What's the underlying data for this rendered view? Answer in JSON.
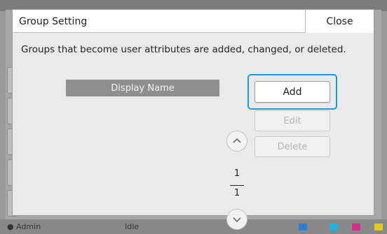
{
  "dialog": {
    "title": "Group Setting",
    "close_label": "Close",
    "description": "Groups that become user attributes are added, changed, or deleted.",
    "column_header": "Display Name",
    "buttons": {
      "add": "Add",
      "edit": "Edit",
      "delete": "Delete"
    },
    "pager": {
      "current": "1",
      "total": "1"
    }
  },
  "background": {
    "user": "Admin",
    "status": "Idle"
  },
  "colors": {
    "highlight": "#1f9ad6",
    "header_bg": "#8f8f8f"
  },
  "icons": {
    "page_up": "chevron-up-icon",
    "page_down": "chevron-down-icon",
    "user": "person-icon"
  }
}
